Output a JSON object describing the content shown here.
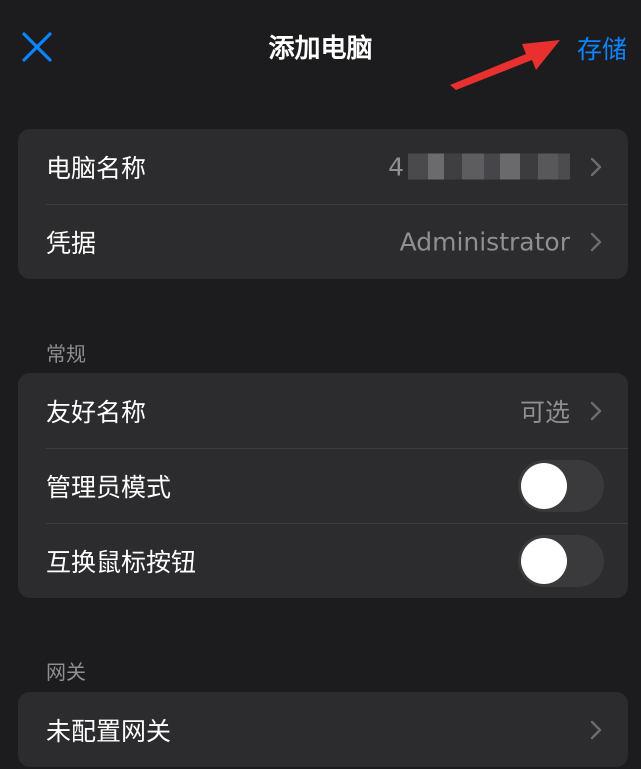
{
  "nav": {
    "title": "添加电脑",
    "save_label": "存储",
    "accent_color": "#0a84ff",
    "close_icon": "close-x-icon",
    "annotation_arrow_color": "#e8312f"
  },
  "groups": {
    "connection": {
      "rows": [
        {
          "label": "电脑名称",
          "value": "4"
        },
        {
          "label": "凭据",
          "value": "Administrator"
        }
      ]
    },
    "general": {
      "header": "常规",
      "rows": [
        {
          "label": "友好名称",
          "value": "可选"
        },
        {
          "label": "管理员模式",
          "toggle": false
        },
        {
          "label": "互换鼠标按钮",
          "toggle": false
        }
      ]
    },
    "gateway": {
      "header": "网关",
      "rows": [
        {
          "label": "未配置网关"
        }
      ]
    }
  }
}
